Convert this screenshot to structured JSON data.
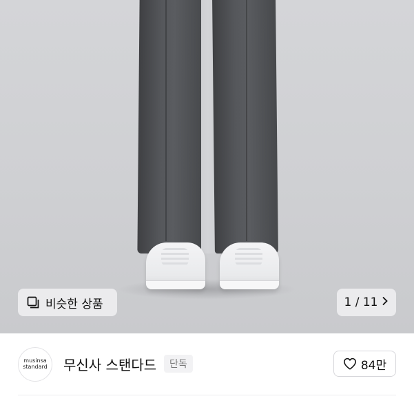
{
  "hero": {
    "similar_button_label": "비슷한 상품",
    "image_counter": "1 / 11",
    "current_image": 1,
    "total_images": 11
  },
  "brand": {
    "logo_line1": "musinsa",
    "logo_line2": "standard",
    "name": "무신사 스탠다드",
    "badge": "단독"
  },
  "like": {
    "count_label": "84만"
  },
  "icons": {
    "similar": "similar-items-icon",
    "next": "chevron-right-icon",
    "like": "heart-outline-icon"
  }
}
